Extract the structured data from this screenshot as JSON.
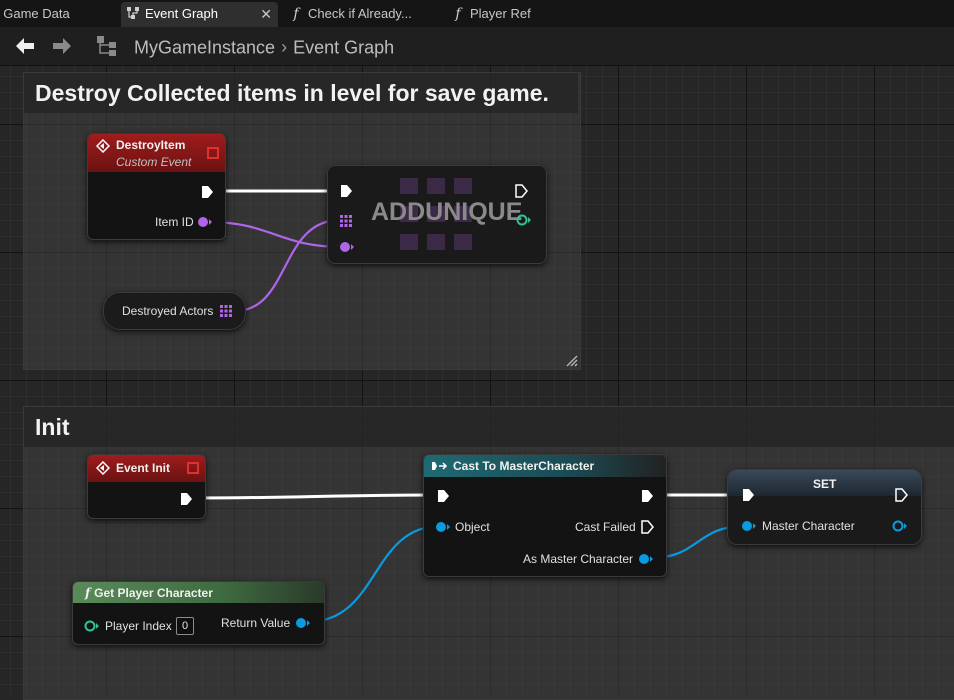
{
  "tabs": [
    {
      "label": "t Game Data",
      "active": false
    },
    {
      "label": "Event Graph",
      "active": true,
      "icon": "event-graph-icon"
    },
    {
      "label": "Check if Already...",
      "active": false,
      "icon": "function-icon"
    },
    {
      "label": "Player Ref",
      "active": false,
      "icon": "function-icon"
    }
  ],
  "nav": {
    "breadcrumb_root": "MyGameInstance",
    "breadcrumb_current": "Event Graph"
  },
  "comments": {
    "destroy": "Destroy Collected items in level for save game.",
    "init": "Init"
  },
  "nodes": {
    "destroy_item": {
      "title": "DestroyItem",
      "subtitle": "Custom Event",
      "pin_item_id": "Item ID"
    },
    "destroyed_actors": {
      "label": "Destroyed Actors"
    },
    "add_unique": {
      "title": "ADDUNIQUE"
    },
    "event_init": {
      "title": "Event Init"
    },
    "cast": {
      "title": "Cast To MasterCharacter",
      "pin_object": "Object",
      "pin_cast_failed": "Cast Failed",
      "pin_as_master": "As Master Character"
    },
    "set": {
      "title": "SET",
      "pin_master": "Master Character"
    },
    "get_player": {
      "title": "Get Player Character",
      "pin_index": "Player Index",
      "index_value": "0",
      "pin_return": "Return Value"
    }
  },
  "colors": {
    "event_header": "#8a1a1a",
    "cast_header": "#1e5f68",
    "function_header": "#48714a",
    "array_pin": "#b064e8",
    "object_pin": "#0a9ae0",
    "wildcard_pin": "#2fc39a",
    "exec": "#ffffff"
  }
}
